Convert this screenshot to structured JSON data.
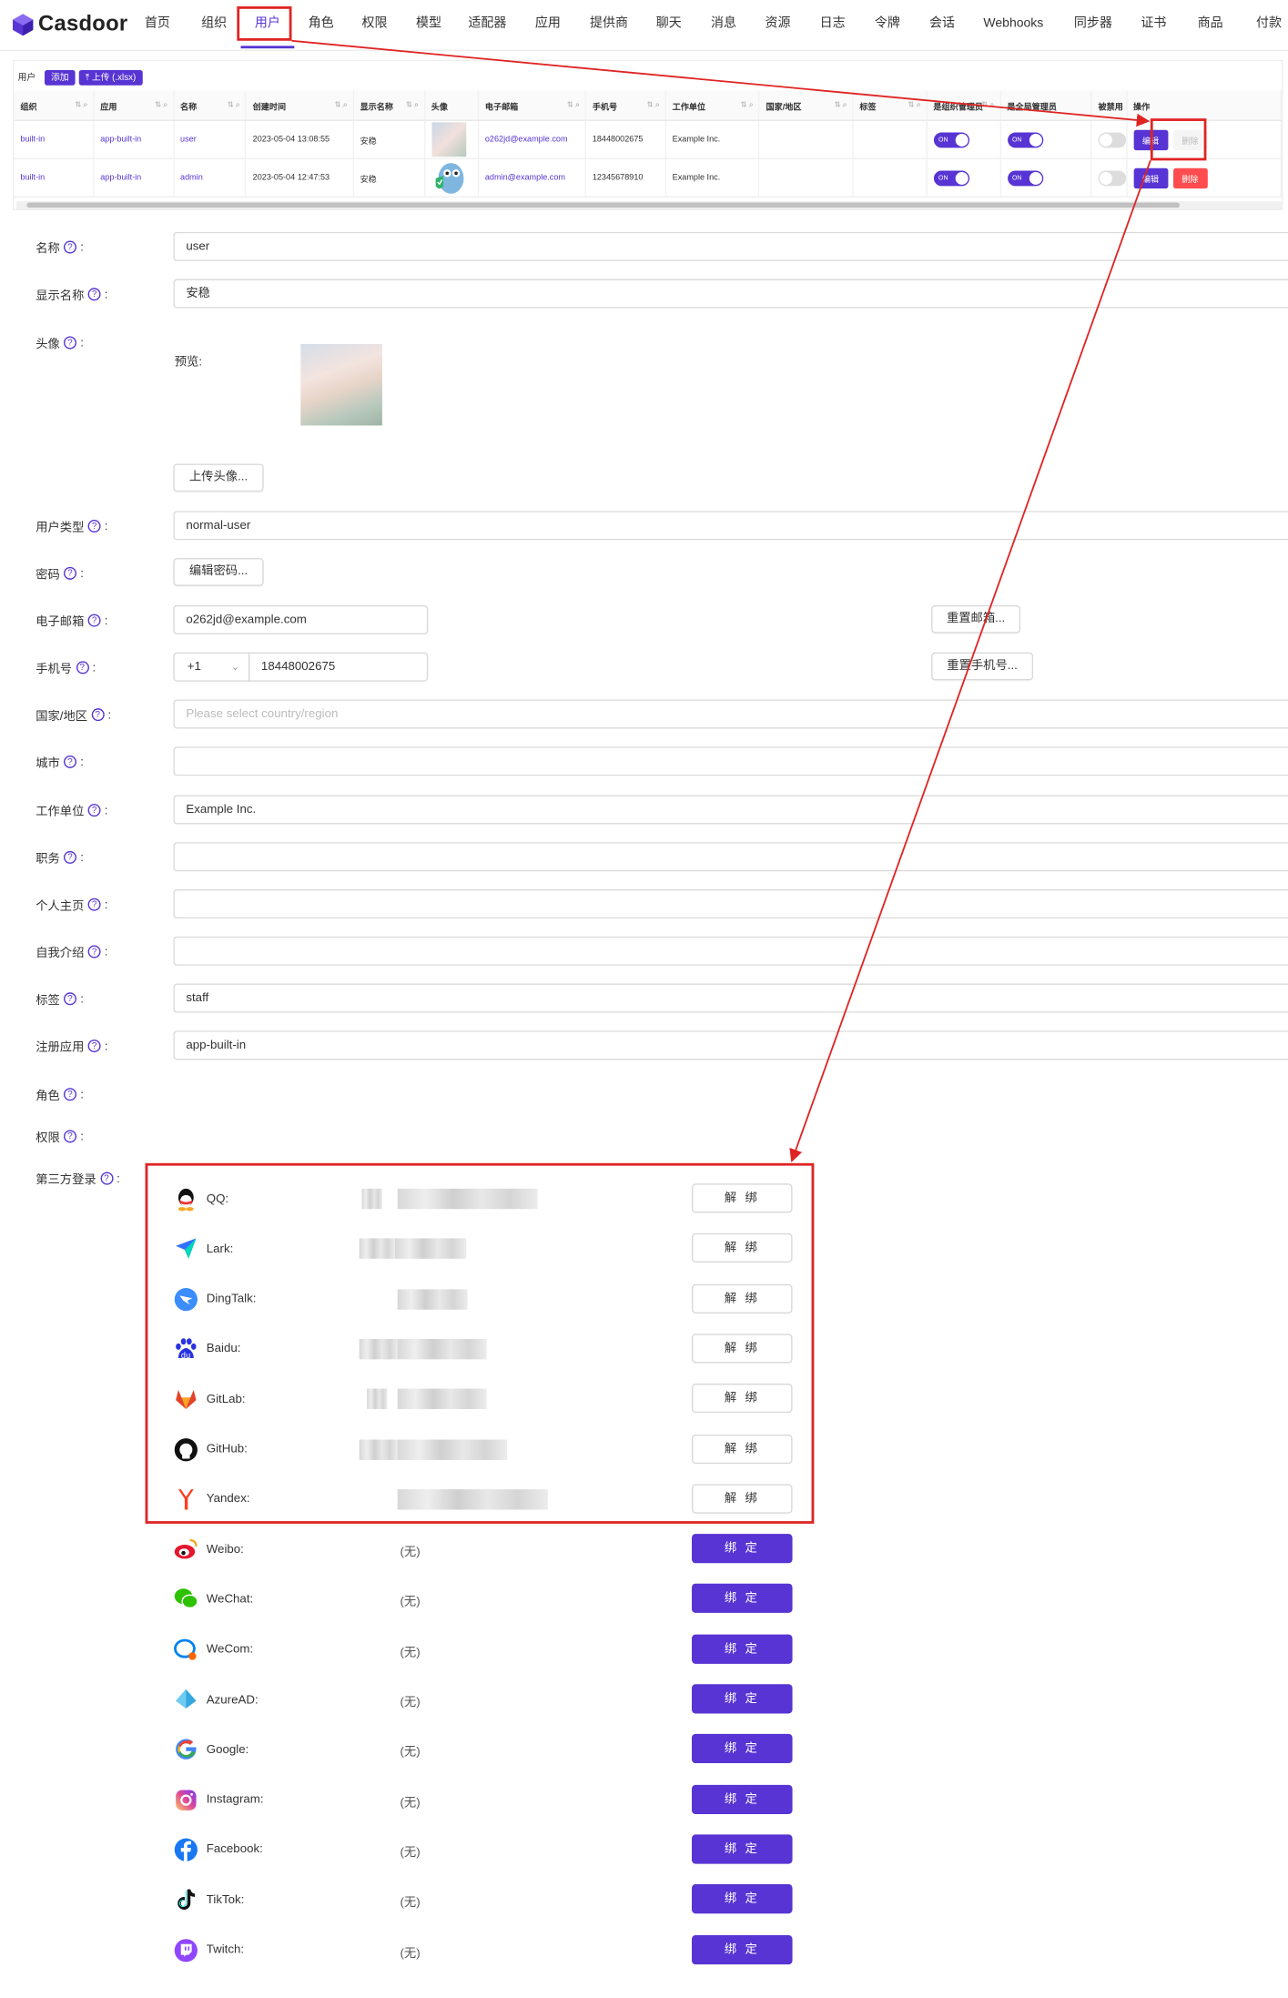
{
  "app": {
    "brand": "Casdoor"
  },
  "nav": [
    {
      "label": "首页"
    },
    {
      "label": "组织"
    },
    {
      "label": "用户",
      "active": true
    },
    {
      "label": "角色"
    },
    {
      "label": "权限"
    },
    {
      "label": "模型"
    },
    {
      "label": "适配器"
    },
    {
      "label": "应用"
    },
    {
      "label": "提供商"
    },
    {
      "label": "聊天"
    },
    {
      "label": "消息"
    },
    {
      "label": "资源"
    },
    {
      "label": "日志"
    },
    {
      "label": "令牌"
    },
    {
      "label": "会话"
    },
    {
      "label": "Webhooks"
    },
    {
      "label": "同步器"
    },
    {
      "label": "证书"
    },
    {
      "label": "商品"
    },
    {
      "label": "付款"
    }
  ],
  "table": {
    "title": "用户",
    "add_label": "添加",
    "upload_label": "上传 (.xlsx)",
    "headers": [
      "组织",
      "应用",
      "名称",
      "创建时间",
      "显示名称",
      "头像",
      "电子邮箱",
      "手机号",
      "工作单位",
      "国家/地区",
      "标签",
      "是组织管理员",
      "是全局管理员",
      "被禁用",
      "操作"
    ],
    "rows": [
      {
        "org": "built-in",
        "app": "app-built-in",
        "name": "user",
        "created": "2023-05-04 13:08:55",
        "display": "安稳",
        "email": "o262jd@example.com",
        "phone": "18448002675",
        "affiliation": "Example Inc.",
        "country": "",
        "tag": "",
        "is_admin": "ON",
        "is_global_admin": "ON",
        "edit": "编辑",
        "delete": "删除"
      },
      {
        "org": "built-in",
        "app": "app-built-in",
        "name": "admin",
        "created": "2023-05-04 12:47:53",
        "display": "安稳",
        "email": "admin@example.com",
        "phone": "12345678910",
        "affiliation": "Example Inc.",
        "country": "",
        "tag": "",
        "is_admin": "ON",
        "is_global_admin": "ON",
        "edit": "编辑",
        "delete": "删除"
      }
    ]
  },
  "form": {
    "name": {
      "label": "名称",
      "value": "user"
    },
    "display_name": {
      "label": "显示名称",
      "value": "安稳"
    },
    "avatar": {
      "label": "头像",
      "preview_label": "预览:",
      "upload_button": "上传头像..."
    },
    "user_type": {
      "label": "用户类型",
      "value": "normal-user"
    },
    "password": {
      "label": "密码",
      "button": "编辑密码..."
    },
    "email": {
      "label": "电子邮箱",
      "value": "o262jd@example.com",
      "button": "重置邮箱..."
    },
    "phone": {
      "label": "手机号",
      "country_code": "+1",
      "value": "18448002675",
      "button": "重置手机号..."
    },
    "country": {
      "label": "国家/地区",
      "placeholder": "Please select country/region"
    },
    "city": {
      "label": "城市",
      "value": ""
    },
    "affiliation": {
      "label": "工作单位",
      "value": "Example Inc."
    },
    "title": {
      "label": "职务",
      "value": ""
    },
    "homepage": {
      "label": "个人主页",
      "value": ""
    },
    "bio": {
      "label": "自我介绍",
      "value": ""
    },
    "tag": {
      "label": "标签",
      "value": "staff"
    },
    "signup_app": {
      "label": "注册应用",
      "value": "app-built-in"
    },
    "roles": {
      "label": "角色"
    },
    "permissions": {
      "label": "权限"
    },
    "third_party": {
      "label": "第三方登录"
    },
    "label_suffix": ":"
  },
  "providers": [
    {
      "name": "QQ:",
      "bound": true,
      "button": "解 绑"
    },
    {
      "name": "Lark:",
      "bound": true,
      "button": "解 绑"
    },
    {
      "name": "DingTalk:",
      "bound": true,
      "button": "解 绑"
    },
    {
      "name": "Baidu:",
      "bound": true,
      "button": "解 绑"
    },
    {
      "name": "GitLab:",
      "bound": true,
      "button": "解 绑"
    },
    {
      "name": "GitHub:",
      "bound": true,
      "button": "解 绑"
    },
    {
      "name": "Yandex:",
      "bound": true,
      "button": "解 绑"
    },
    {
      "name": "Weibo:",
      "bound": false,
      "value": "(无)",
      "button": "绑 定"
    },
    {
      "name": "WeChat:",
      "bound": false,
      "value": "(无)",
      "button": "绑 定"
    },
    {
      "name": "WeCom:",
      "bound": false,
      "value": "(无)",
      "button": "绑 定"
    },
    {
      "name": "AzureAD:",
      "bound": false,
      "value": "(无)",
      "button": "绑 定"
    },
    {
      "name": "Google:",
      "bound": false,
      "value": "(无)",
      "button": "绑 定"
    },
    {
      "name": "Instagram:",
      "bound": false,
      "value": "(无)",
      "button": "绑 定"
    },
    {
      "name": "Facebook:",
      "bound": false,
      "value": "(无)",
      "button": "绑 定"
    },
    {
      "name": "TikTok:",
      "bound": false,
      "value": "(无)",
      "button": "绑 定"
    },
    {
      "name": "Twitch:",
      "bound": false,
      "value": "(无)",
      "button": "绑 定"
    }
  ],
  "colors": {
    "accent": "#5734d3",
    "danger": "#ff4d4f",
    "annotation": "#e02424"
  }
}
